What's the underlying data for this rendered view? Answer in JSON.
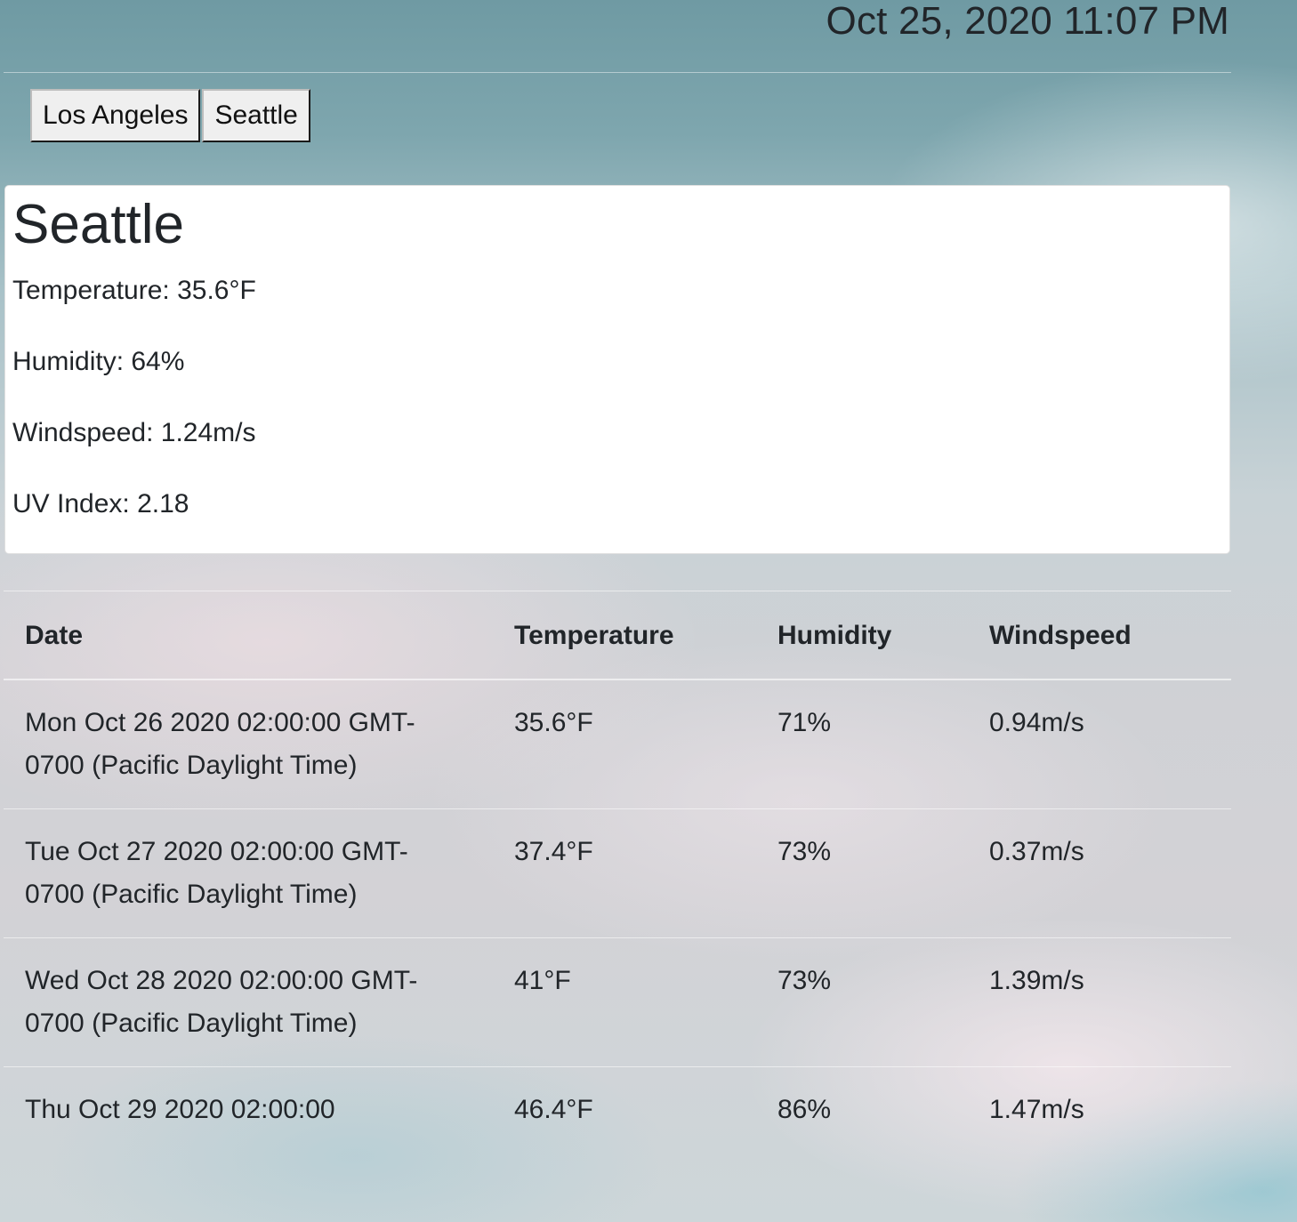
{
  "header": {
    "datetime": "Oct 25, 2020 11:07 PM"
  },
  "city_buttons": [
    {
      "label": "Los Angeles"
    },
    {
      "label": "Seattle"
    }
  ],
  "current": {
    "city": "Seattle",
    "temperature": "Temperature: 35.6°F",
    "humidity": "Humidity: 64%",
    "windspeed": "Windspeed: 1.24m/s",
    "uv_index": "UV Index: 2.18"
  },
  "forecast": {
    "columns": [
      "Date",
      "Temperature",
      "Humidity",
      "Windspeed"
    ],
    "rows": [
      {
        "date": "Mon Oct 26 2020 02:00:00 GMT-0700 (Pacific Daylight Time)",
        "temperature": "35.6°F",
        "humidity": "71%",
        "windspeed": "0.94m/s"
      },
      {
        "date": "Tue Oct 27 2020 02:00:00 GMT-0700 (Pacific Daylight Time)",
        "temperature": "37.4°F",
        "humidity": "73%",
        "windspeed": "0.37m/s"
      },
      {
        "date": "Wed Oct 28 2020 02:00:00 GMT-0700 (Pacific Daylight Time)",
        "temperature": "41°F",
        "humidity": "73%",
        "windspeed": "1.39m/s"
      },
      {
        "date": "Thu Oct 29 2020 02:00:00",
        "temperature": "46.4°F",
        "humidity": "86%",
        "windspeed": "1.47m/s"
      }
    ]
  }
}
